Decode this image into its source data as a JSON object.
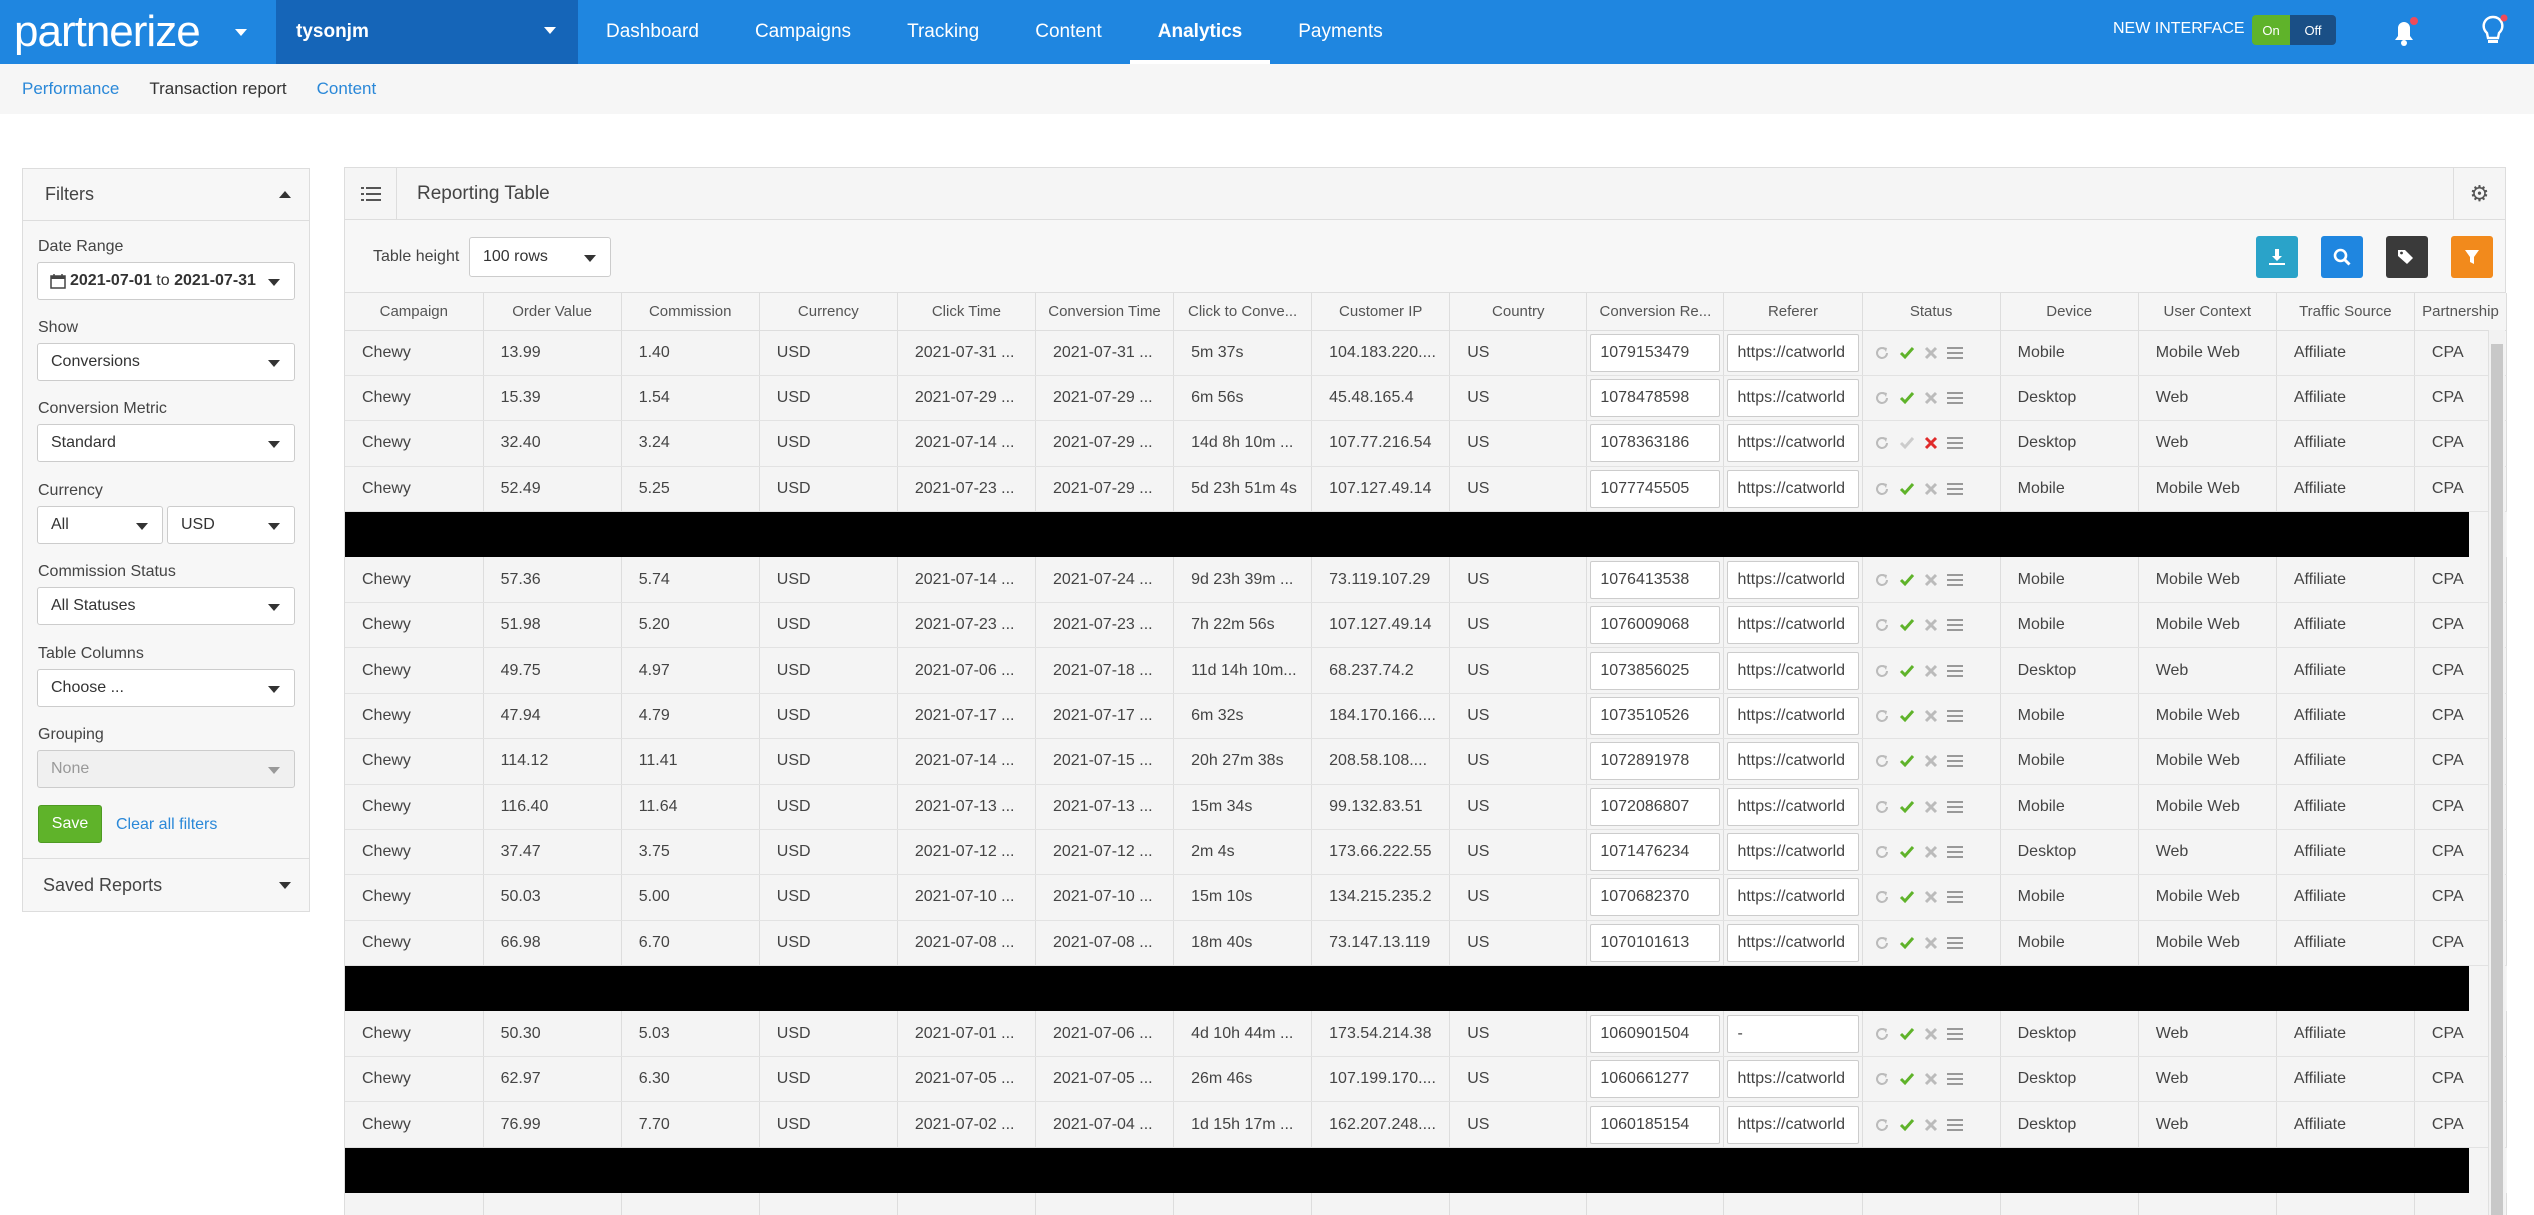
{
  "brand": {
    "name": "partnerize",
    "accent": "#1f86e0",
    "green": "#5fb32a"
  },
  "account": {
    "name": "tysonjm"
  },
  "nav": [
    {
      "label": "Dashboard",
      "active": false
    },
    {
      "label": "Campaigns",
      "active": false
    },
    {
      "label": "Tracking",
      "active": false
    },
    {
      "label": "Content",
      "active": false
    },
    {
      "label": "Analytics",
      "active": true
    },
    {
      "label": "Payments",
      "active": false
    }
  ],
  "header": {
    "new_interface": "NEW INTERFACE",
    "on": "On",
    "off": "Off"
  },
  "subnav": [
    {
      "label": "Performance"
    },
    {
      "label": "Transaction report"
    },
    {
      "label": "Content"
    }
  ],
  "filters": {
    "title": "Filters",
    "date_label": "Date Range",
    "date_from": "2021-07-01",
    "date_to_word": "to",
    "date_to": "2021-07-31",
    "show_label": "Show",
    "show_value": "Conversions",
    "metric_label": "Conversion Metric",
    "metric_value": "Standard",
    "currency_label": "Currency",
    "currency_scope": "All",
    "currency_value": "USD",
    "status_label": "Commission Status",
    "status_value": "All Statuses",
    "columns_label": "Table Columns",
    "columns_placeholder": "Choose ...",
    "grouping_label": "Grouping",
    "grouping_value": "None",
    "save": "Save",
    "clear": "Clear all filters",
    "saved_reports": "Saved Reports"
  },
  "table": {
    "title": "Reporting Table",
    "height_label": "Table height",
    "height_value": "100 rows",
    "columns": [
      "Campaign",
      "Order Value",
      "Commission",
      "Currency",
      "Click Time",
      "Conversion Time",
      "Click to Conve...",
      "Customer IP",
      "Country",
      "Conversion Re...",
      "Referer",
      "Status",
      "Device",
      "User Context",
      "Traffic Source",
      "Partnership"
    ],
    "row_groups": [
      [
        {
          "campaign": "Chewy",
          "order_value": "13.99",
          "commission": "1.40",
          "currency": "USD",
          "click_time": "2021-07-31 ...",
          "conversion_time": "2021-07-31 ...",
          "click_to_conv": "5m 37s",
          "ip": "104.183.220....",
          "country": "US",
          "conv_ref": "1079153479",
          "referer": "https://catworld",
          "status": "approved",
          "device": "Mobile",
          "context": "Mobile Web",
          "source": "Affiliate",
          "partnership": "CPA"
        },
        {
          "campaign": "Chewy",
          "order_value": "15.39",
          "commission": "1.54",
          "currency": "USD",
          "click_time": "2021-07-29 ...",
          "conversion_time": "2021-07-29 ...",
          "click_to_conv": "6m 56s",
          "ip": "45.48.165.4",
          "country": "US",
          "conv_ref": "1078478598",
          "referer": "https://catworld",
          "status": "approved",
          "device": "Desktop",
          "context": "Web",
          "source": "Affiliate",
          "partnership": "CPA"
        },
        {
          "campaign": "Chewy",
          "order_value": "32.40",
          "commission": "3.24",
          "currency": "USD",
          "click_time": "2021-07-14 ...",
          "conversion_time": "2021-07-29 ...",
          "click_to_conv": "14d 8h 10m ...",
          "ip": "107.77.216.54",
          "country": "US",
          "conv_ref": "1078363186",
          "referer": "https://catworld",
          "status": "rejected",
          "device": "Desktop",
          "context": "Web",
          "source": "Affiliate",
          "partnership": "CPA"
        },
        {
          "campaign": "Chewy",
          "order_value": "52.49",
          "commission": "5.25",
          "currency": "USD",
          "click_time": "2021-07-23 ...",
          "conversion_time": "2021-07-29 ...",
          "click_to_conv": "5d 23h 51m 4s",
          "ip": "107.127.49.14",
          "country": "US",
          "conv_ref": "1077745505",
          "referer": "https://catworld",
          "status": "approved",
          "device": "Mobile",
          "context": "Mobile Web",
          "source": "Affiliate",
          "partnership": "CPA"
        }
      ],
      [
        {
          "campaign": "Chewy",
          "order_value": "57.36",
          "commission": "5.74",
          "currency": "USD",
          "click_time": "2021-07-14 ...",
          "conversion_time": "2021-07-24 ...",
          "click_to_conv": "9d 23h 39m ...",
          "ip": "73.119.107.29",
          "country": "US",
          "conv_ref": "1076413538",
          "referer": "https://catworld",
          "status": "approved",
          "device": "Mobile",
          "context": "Mobile Web",
          "source": "Affiliate",
          "partnership": "CPA"
        },
        {
          "campaign": "Chewy",
          "order_value": "51.98",
          "commission": "5.20",
          "currency": "USD",
          "click_time": "2021-07-23 ...",
          "conversion_time": "2021-07-23 ...",
          "click_to_conv": "7h 22m 56s",
          "ip": "107.127.49.14",
          "country": "US",
          "conv_ref": "1076009068",
          "referer": "https://catworld",
          "status": "approved",
          "device": "Mobile",
          "context": "Mobile Web",
          "source": "Affiliate",
          "partnership": "CPA"
        },
        {
          "campaign": "Chewy",
          "order_value": "49.75",
          "commission": "4.97",
          "currency": "USD",
          "click_time": "2021-07-06 ...",
          "conversion_time": "2021-07-18 ...",
          "click_to_conv": "11d 14h 10m...",
          "ip": "68.237.74.2",
          "country": "US",
          "conv_ref": "1073856025",
          "referer": "https://catworld",
          "status": "approved",
          "device": "Desktop",
          "context": "Web",
          "source": "Affiliate",
          "partnership": "CPA"
        },
        {
          "campaign": "Chewy",
          "order_value": "47.94",
          "commission": "4.79",
          "currency": "USD",
          "click_time": "2021-07-17 ...",
          "conversion_time": "2021-07-17 ...",
          "click_to_conv": "6m 32s",
          "ip": "184.170.166....",
          "country": "US",
          "conv_ref": "1073510526",
          "referer": "https://catworld",
          "status": "approved",
          "device": "Mobile",
          "context": "Mobile Web",
          "source": "Affiliate",
          "partnership": "CPA"
        },
        {
          "campaign": "Chewy",
          "order_value": "114.12",
          "commission": "11.41",
          "currency": "USD",
          "click_time": "2021-07-14 ...",
          "conversion_time": "2021-07-15 ...",
          "click_to_conv": "20h 27m 38s",
          "ip": "208.58.108....",
          "country": "US",
          "conv_ref": "1072891978",
          "referer": "https://catworld",
          "status": "approved",
          "device": "Mobile",
          "context": "Mobile Web",
          "source": "Affiliate",
          "partnership": "CPA"
        },
        {
          "campaign": "Chewy",
          "order_value": "116.40",
          "commission": "11.64",
          "currency": "USD",
          "click_time": "2021-07-13 ...",
          "conversion_time": "2021-07-13 ...",
          "click_to_conv": "15m 34s",
          "ip": "99.132.83.51",
          "country": "US",
          "conv_ref": "1072086807",
          "referer": "https://catworld",
          "status": "approved",
          "device": "Mobile",
          "context": "Mobile Web",
          "source": "Affiliate",
          "partnership": "CPA"
        },
        {
          "campaign": "Chewy",
          "order_value": "37.47",
          "commission": "3.75",
          "currency": "USD",
          "click_time": "2021-07-12 ...",
          "conversion_time": "2021-07-12 ...",
          "click_to_conv": "2m 4s",
          "ip": "173.66.222.55",
          "country": "US",
          "conv_ref": "1071476234",
          "referer": "https://catworld",
          "status": "approved",
          "device": "Desktop",
          "context": "Web",
          "source": "Affiliate",
          "partnership": "CPA"
        },
        {
          "campaign": "Chewy",
          "order_value": "50.03",
          "commission": "5.00",
          "currency": "USD",
          "click_time": "2021-07-10 ...",
          "conversion_time": "2021-07-10 ...",
          "click_to_conv": "15m 10s",
          "ip": "134.215.235.2",
          "country": "US",
          "conv_ref": "1070682370",
          "referer": "https://catworld",
          "status": "approved",
          "device": "Mobile",
          "context": "Mobile Web",
          "source": "Affiliate",
          "partnership": "CPA"
        },
        {
          "campaign": "Chewy",
          "order_value": "66.98",
          "commission": "6.70",
          "currency": "USD",
          "click_time": "2021-07-08 ...",
          "conversion_time": "2021-07-08 ...",
          "click_to_conv": "18m 40s",
          "ip": "73.147.13.119",
          "country": "US",
          "conv_ref": "1070101613",
          "referer": "https://catworld",
          "status": "approved",
          "device": "Mobile",
          "context": "Mobile Web",
          "source": "Affiliate",
          "partnership": "CPA"
        }
      ],
      [
        {
          "campaign": "Chewy",
          "order_value": "50.30",
          "commission": "5.03",
          "currency": "USD",
          "click_time": "2021-07-01 ...",
          "conversion_time": "2021-07-06 ...",
          "click_to_conv": "4d 10h 44m ...",
          "ip": "173.54.214.38",
          "country": "US",
          "conv_ref": "1060901504",
          "referer": "-",
          "status": "approved",
          "device": "Desktop",
          "context": "Web",
          "source": "Affiliate",
          "partnership": "CPA"
        },
        {
          "campaign": "Chewy",
          "order_value": "62.97",
          "commission": "6.30",
          "currency": "USD",
          "click_time": "2021-07-05 ...",
          "conversion_time": "2021-07-05 ...",
          "click_to_conv": "26m 46s",
          "ip": "107.199.170....",
          "country": "US",
          "conv_ref": "1060661277",
          "referer": "https://catworld",
          "status": "approved",
          "device": "Desktop",
          "context": "Web",
          "source": "Affiliate",
          "partnership": "CPA"
        },
        {
          "campaign": "Chewy",
          "order_value": "76.99",
          "commission": "7.70",
          "currency": "USD",
          "click_time": "2021-07-02 ...",
          "conversion_time": "2021-07-04 ...",
          "click_to_conv": "1d 15h 17m ...",
          "ip": "162.207.248....",
          "country": "US",
          "conv_ref": "1060185154",
          "referer": "https://catworld",
          "status": "approved",
          "device": "Desktop",
          "context": "Web",
          "source": "Affiliate",
          "partnership": "CPA"
        }
      ]
    ]
  }
}
